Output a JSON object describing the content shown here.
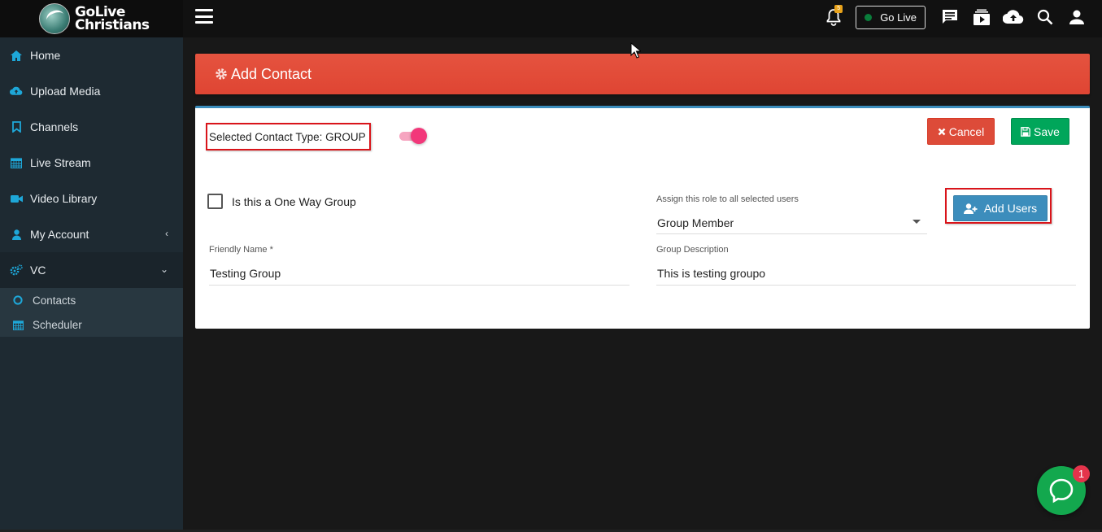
{
  "brand": {
    "line1": "GoLive",
    "line2": "Christians"
  },
  "topbar": {
    "notification_count": "5",
    "golive_label": "Go Live",
    "icons": [
      "bell-icon",
      "chat-message-icon",
      "media-library-icon",
      "cloud-upload-icon",
      "search-icon",
      "user-icon"
    ]
  },
  "sidebar": {
    "items": [
      {
        "label": "Home",
        "icon": "home-icon"
      },
      {
        "label": "Upload Media",
        "icon": "cloud-upload-icon"
      },
      {
        "label": "Channels",
        "icon": "bookmark-icon"
      },
      {
        "label": "Live Stream",
        "icon": "calendar-icon"
      },
      {
        "label": "Video Library",
        "icon": "video-camera-icon"
      },
      {
        "label": "My Account",
        "icon": "user-icon"
      },
      {
        "label": "VC",
        "icon": "cogs-icon"
      }
    ],
    "sub_items": [
      {
        "label": "Contacts",
        "icon": "circle-icon"
      },
      {
        "label": "Scheduler",
        "icon": "calendar-icon"
      }
    ]
  },
  "page": {
    "title": "Add Contact",
    "contact_type_text": "Selected Contact Type: GROUP",
    "cancel_label": "Cancel",
    "save_label": "Save",
    "one_way_label": "Is this a One Way Group",
    "role_label": "Assign this role to all selected users",
    "role_value": "Group Member",
    "add_users_label": "Add Users",
    "friendly_name_label": "Friendly Name *",
    "friendly_name_value": "Testing Group",
    "description_label": "Group Description",
    "description_value": "This is testing groupo"
  },
  "chat_widget": {
    "badge": "1"
  },
  "colors": {
    "header_red": "#df4533",
    "card_border": "#3c8dbc",
    "cancel": "#dd4b39",
    "save": "#00a65a",
    "add_users": "#3c8dbc",
    "toggle": "#f2387a",
    "sidebar_bg": "#1e2a32",
    "accent_icon": "#1ea7d8",
    "chat": "#13a84e"
  }
}
